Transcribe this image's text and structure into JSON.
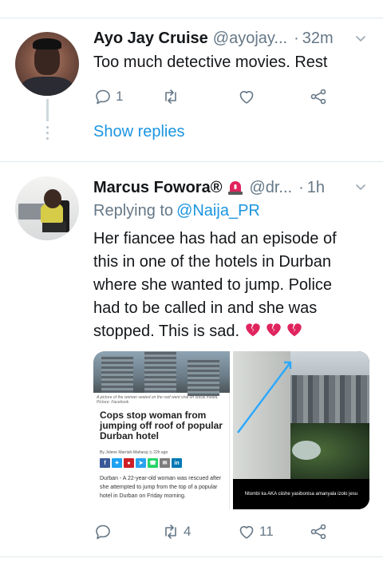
{
  "tweet1": {
    "name": "Ayo Jay Cruise",
    "handle": "@ayojay...",
    "separator": "·",
    "time": "32m",
    "text": "Too much detective movies. Rest",
    "reply_count": "1",
    "retweet_count": "",
    "like_count": "",
    "show_replies": "Show replies"
  },
  "tweet2": {
    "name": "Marcus Fowora®",
    "handle": "@dr...",
    "separator": "·",
    "time": "1h",
    "replying_prefix": "Replying to",
    "replying_to": "@Naija_PR",
    "text_lines": [
      "Her fiancee has had an episode of",
      "this in one of the hotels in Durban",
      "where she wanted to jump. Police",
      "had to be called in and she was",
      "stopped. This is sad."
    ],
    "reply_count": "",
    "retweet_count": "4",
    "like_count": "11",
    "media": {
      "left": {
        "caption": "A picture of the woman seated on the roof went viral on social media. Picture: Facebook",
        "headline": "Cops stop woman from jumping off roof of popular Durban hotel",
        "byline": "By Jolene Marriah-Maharaj",
        "age": "22h ago",
        "body": "Durban - A 22-year-old woman was rescued after she attempted to jump from the top of a popular hotel in Durban on Friday morning."
      },
      "right": {
        "caption": "Ntombi ka AKA ciishe yasibonisa amanyala izolo jesu"
      }
    }
  },
  "colors": {
    "accent": "#1b95e0",
    "muted": "#657786",
    "text": "#14171a",
    "divider": "#e1e8ed",
    "broken_heart": "#e0245e"
  },
  "icons": [
    "reply-icon",
    "retweet-icon",
    "like-icon",
    "share-icon",
    "caret-down-icon",
    "broken-heart-icon",
    "siren-emoji-icon"
  ]
}
